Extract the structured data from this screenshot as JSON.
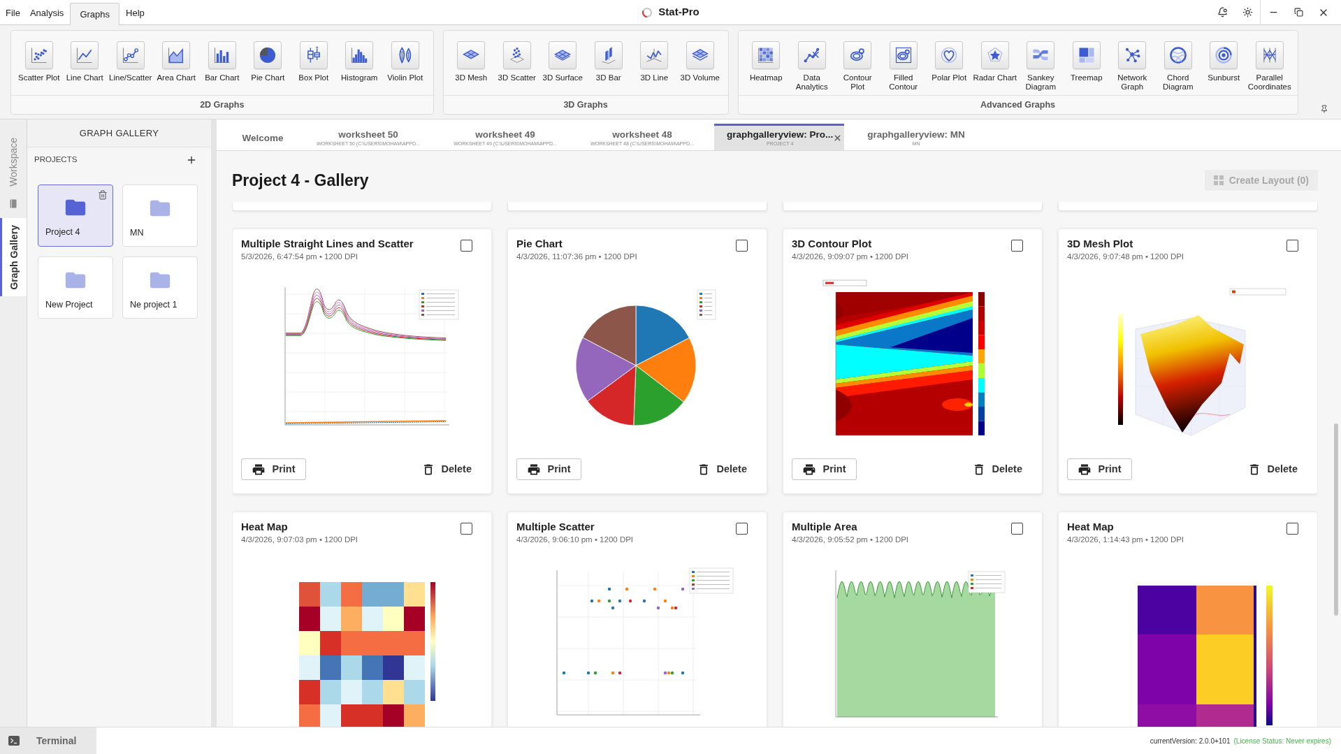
{
  "menu": [
    {
      "label": "File",
      "selected": false
    },
    {
      "label": "Analysis",
      "selected": false
    },
    {
      "label": "Graphs",
      "selected": true
    },
    {
      "label": "Help",
      "selected": false
    }
  ],
  "app_title": "Stat-Pro",
  "ribbon": [
    {
      "label": "2D Graphs",
      "items": [
        {
          "label": "Scatter Plot",
          "kind": "scatter"
        },
        {
          "label": "Line Chart",
          "kind": "line"
        },
        {
          "label": "Line/Scatter",
          "kind": "linescatter"
        },
        {
          "label": "Area Chart",
          "kind": "area"
        },
        {
          "label": "Bar Chart",
          "kind": "bar"
        },
        {
          "label": "Pie Chart",
          "kind": "pie"
        },
        {
          "label": "Box Plot",
          "kind": "box"
        },
        {
          "label": "Histogram",
          "kind": "histogram"
        },
        {
          "label": "Violin Plot",
          "kind": "violin"
        }
      ]
    },
    {
      "label": "3D Graphs",
      "items": [
        {
          "label": "3D Mesh",
          "kind": "mesh"
        },
        {
          "label": "3D Scatter",
          "kind": "scatter3d"
        },
        {
          "label": "3D Surface",
          "kind": "surface"
        },
        {
          "label": "3D Bar",
          "kind": "bar3d"
        },
        {
          "label": "3D Line",
          "kind": "line3d"
        },
        {
          "label": "3D Volume",
          "kind": "volume"
        }
      ]
    },
    {
      "label": "Advanced Graphs",
      "items": [
        {
          "label": "Heatmap",
          "kind": "heatmap"
        },
        {
          "label": "Data\nAnalytics",
          "kind": "analytics"
        },
        {
          "label": "Contour\nPlot",
          "kind": "contour"
        },
        {
          "label": "Filled\nContour",
          "kind": "filledcontour"
        },
        {
          "label": "Polar Plot",
          "kind": "polar"
        },
        {
          "label": "Radar Chart",
          "kind": "radar"
        },
        {
          "label": "Sankey\nDiagram",
          "kind": "sankey"
        },
        {
          "label": "Treemap",
          "kind": "treemap"
        },
        {
          "label": "Network\nGraph",
          "kind": "network"
        },
        {
          "label": "Chord\nDiagram",
          "kind": "chord"
        },
        {
          "label": "Sunburst",
          "kind": "sunburst"
        },
        {
          "label": "Parallel\nCoordinates",
          "kind": "parallel"
        }
      ]
    }
  ],
  "sidebar": {
    "rail": [
      {
        "kind": "text",
        "label": "Workspace",
        "selected": false
      },
      {
        "kind": "icon",
        "selected": false
      },
      {
        "kind": "text",
        "label": "Graph Gallery",
        "selected": true
      }
    ],
    "title": "GRAPH GALLERY",
    "projects_label": "PROJECTS",
    "projects": [
      {
        "name": "Project 4",
        "selected": true
      },
      {
        "name": "MN",
        "selected": false
      },
      {
        "name": "New Project",
        "selected": false
      },
      {
        "name": "Ne project 1",
        "selected": false
      }
    ]
  },
  "tabs": [
    {
      "title": "Welcome",
      "selected": false
    },
    {
      "title": "worksheet 50",
      "subtitle": "WORKSHEET 50 (C:\\USERS\\MOHAM\\APPD...",
      "selected": false
    },
    {
      "title": "worksheet 49",
      "subtitle": "WORKSHEET 49 (C:\\USERS\\MOHAM\\APPD...",
      "selected": false
    },
    {
      "title": "worksheet 48",
      "subtitle": "WORKSHEET 48 (C:\\USERS\\MOHAM\\APPD...",
      "selected": false
    },
    {
      "title": "graphgalleryview: Pro...",
      "subtitle": "PROJECT 4",
      "selected": true
    },
    {
      "title": "graphgalleryview: MN",
      "subtitle": "MN",
      "selected": false
    }
  ],
  "gallery": {
    "title": "Project 4 - Gallery",
    "create_layout": {
      "label": "Create Layout (0)",
      "disabled": true
    },
    "cards": [
      {
        "title": "Multiple Straight Lines and Scatter",
        "meta": "5/3/2026, 6:47:54 pm • 1200 DPI",
        "kind": "line",
        "checked": false,
        "actions": {
          "print": "Print",
          "delete": "Delete"
        }
      },
      {
        "title": "Pie Chart",
        "meta": "4/3/2026, 11:07:36 pm • 1200 DPI",
        "kind": "pie",
        "checked": false,
        "actions": {
          "print": "Print",
          "delete": "Delete"
        }
      },
      {
        "title": "3D Contour Plot",
        "meta": "4/3/2026, 9:09:07 pm • 1200 DPI",
        "kind": "contour",
        "checked": false,
        "actions": {
          "print": "Print",
          "delete": "Delete"
        }
      },
      {
        "title": "3D Mesh Plot",
        "meta": "4/3/2026, 9:07:48 pm • 1200 DPI",
        "kind": "mesh",
        "checked": false,
        "actions": {
          "print": "Print",
          "delete": "Delete"
        }
      },
      {
        "title": "Heat Map",
        "meta": "4/3/2026, 9:07:03 pm • 1200 DPI",
        "kind": "heatmap",
        "checked": false
      },
      {
        "title": "Multiple Scatter",
        "meta": "4/3/2026, 9:06:10 pm • 1200 DPI",
        "kind": "scatter",
        "checked": false
      },
      {
        "title": "Multiple Area",
        "meta": "4/3/2026, 9:05:52 pm • 1200 DPI",
        "kind": "area",
        "checked": false
      },
      {
        "title": "Heat Map",
        "meta": "4/3/2026, 1:14:43 pm • 1200 DPI",
        "kind": "plasmamap",
        "checked": false
      }
    ]
  },
  "status_bar": {
    "terminal": "Terminal",
    "version": "currentVersion: 2.0.0+101",
    "license": "(License Status: Never expires)"
  }
}
